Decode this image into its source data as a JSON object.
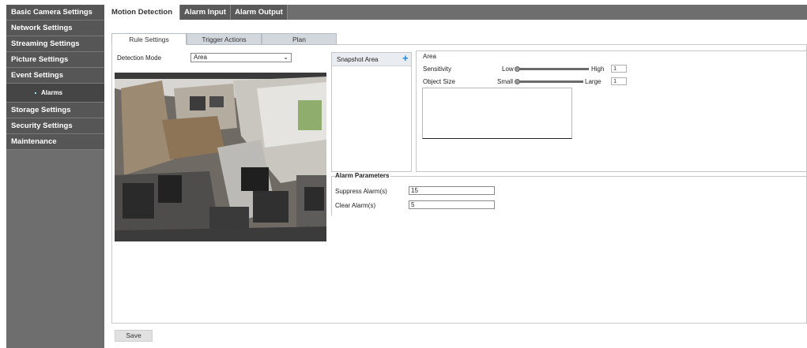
{
  "sidebar": {
    "items": [
      {
        "label": "Basic Camera Settings"
      },
      {
        "label": "Network Settings"
      },
      {
        "label": "Streaming Settings"
      },
      {
        "label": "Picture Settings"
      },
      {
        "label": "Event Settings"
      },
      {
        "label": "Alarms"
      },
      {
        "label": "Storage Settings"
      },
      {
        "label": "Security Settings"
      },
      {
        "label": "Maintenance"
      }
    ]
  },
  "top_tabs": [
    {
      "label": "Motion Detection",
      "active": true
    },
    {
      "label": "Alarm Input",
      "active": false
    },
    {
      "label": "Alarm Output",
      "active": false
    }
  ],
  "sub_tabs": [
    {
      "label": "Rule Settings",
      "active": true
    },
    {
      "label": "Trigger Actions",
      "active": false
    },
    {
      "label": "Plan",
      "active": false
    }
  ],
  "detection": {
    "label": "Detection Mode",
    "value": "Area"
  },
  "snapshot": {
    "label": "Snapshot Area",
    "add_icon": "plus-icon"
  },
  "area": {
    "title": "Area",
    "sensitivity": {
      "label": "Sensitivity",
      "low": "Low",
      "high": "High",
      "value": "1"
    },
    "object_size": {
      "label": "Object Size",
      "small": "Small",
      "large": "Large",
      "value": "1"
    }
  },
  "alarm": {
    "title": "Alarm Parameters",
    "suppress": {
      "label": "Suppress Alarm(s)",
      "value": "15"
    },
    "clear": {
      "label": "Clear Alarm(s)",
      "value": "5"
    }
  },
  "actions": {
    "save_label": "Save"
  },
  "colors": {
    "sidebar_bg": "#6e6e6e",
    "sidebar_item_bg": "#565656",
    "active_tab_bg": "#ffffff",
    "accent_plus": "#1f86d6"
  }
}
